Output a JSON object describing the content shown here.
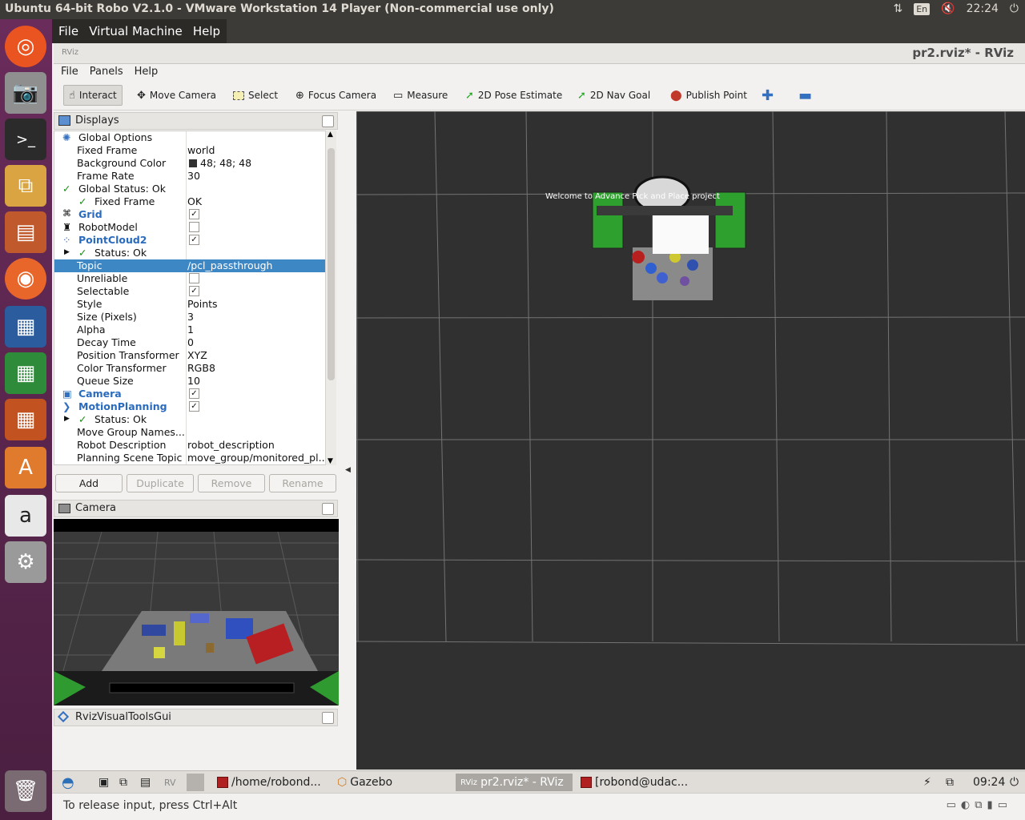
{
  "host_bar": {
    "title": "Ubuntu 64-bit Robo V2.1.0 - VMware Workstation 14 Player (Non-commercial use only)",
    "lang": "En",
    "clock": "22:24"
  },
  "vm_menu": [
    "File",
    "Virtual Machine",
    "Help"
  ],
  "window": {
    "title": "pr2.rviz* - RViz",
    "logo": "RViz",
    "menu": [
      "File",
      "Panels",
      "Help"
    ]
  },
  "toolbar": {
    "tools": [
      {
        "label": "Interact",
        "icon": "hand-icon",
        "active": true
      },
      {
        "label": "Move Camera",
        "icon": "move-camera-icon"
      },
      {
        "label": "Select",
        "icon": "select-icon"
      },
      {
        "label": "Focus Camera",
        "icon": "focus-camera-icon"
      },
      {
        "label": "Measure",
        "icon": "measure-icon"
      },
      {
        "label": "2D Pose Estimate",
        "icon": "pose-arrow-icon"
      },
      {
        "label": "2D Nav Goal",
        "icon": "nav-arrow-icon"
      },
      {
        "label": "Publish Point",
        "icon": "map-pin-icon"
      }
    ]
  },
  "displays": {
    "title": "Displays",
    "rows": [
      {
        "name": "Global Options",
        "value": ""
      },
      {
        "name": "Fixed Frame",
        "value": "world"
      },
      {
        "name": "Background Color",
        "value": "48; 48; 48"
      },
      {
        "name": "Frame Rate",
        "value": "30"
      },
      {
        "name": "Global Status: Ok",
        "value": ""
      },
      {
        "name": "Fixed Frame",
        "value": "OK"
      },
      {
        "name": "Grid",
        "value": ""
      },
      {
        "name": "RobotModel",
        "value": ""
      },
      {
        "name": "PointCloud2",
        "value": ""
      },
      {
        "name": "Status: Ok",
        "value": ""
      },
      {
        "name": "Topic",
        "value": "/pcl_passthrough"
      },
      {
        "name": "Unreliable",
        "value": ""
      },
      {
        "name": "Selectable",
        "value": ""
      },
      {
        "name": "Style",
        "value": "Points"
      },
      {
        "name": "Size (Pixels)",
        "value": "3"
      },
      {
        "name": "Alpha",
        "value": "1"
      },
      {
        "name": "Decay Time",
        "value": "0"
      },
      {
        "name": "Position Transformer",
        "value": "XYZ"
      },
      {
        "name": "Color Transformer",
        "value": "RGB8"
      },
      {
        "name": "Queue Size",
        "value": "10"
      },
      {
        "name": "Camera",
        "value": ""
      },
      {
        "name": "MotionPlanning",
        "value": ""
      },
      {
        "name": "Status: Ok",
        "value": ""
      },
      {
        "name": "Move Group Names...",
        "value": ""
      },
      {
        "name": "Robot Description",
        "value": "robot_description"
      },
      {
        "name": "Planning Scene Topic",
        "value": "move_group/monitored_pl..."
      }
    ],
    "buttons": [
      "Add",
      "Duplicate",
      "Remove",
      "Rename"
    ]
  },
  "camera_panel": {
    "title": "Camera"
  },
  "rviz_visual_tools": {
    "title": "RvizVisualToolsGui"
  },
  "viewport": {
    "overlay_text": "Welcome  to  Advance  Pick  and  Place  project",
    "background": "#303030"
  },
  "taskbar": {
    "items": [
      "/home/robond...",
      "Gazebo",
      "pr2.rviz* - RViz",
      "[robond@udac..."
    ],
    "clock": "09:24"
  },
  "status_bar": {
    "text": "To release input, press Ctrl+Alt"
  }
}
